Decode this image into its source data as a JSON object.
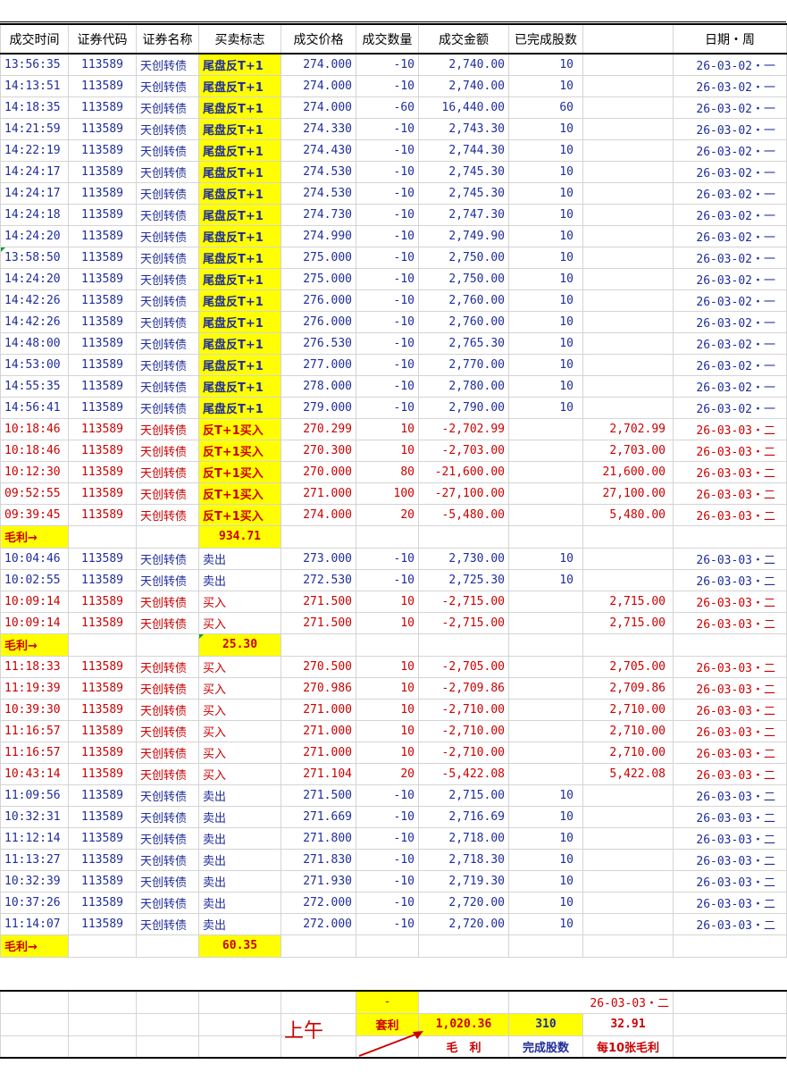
{
  "headers": [
    "成交时间",
    "证券代码",
    "证券名称",
    "买卖标志",
    "成交价格",
    "成交数量",
    "成交金额",
    "已完成股数",
    "",
    "日期・周"
  ],
  "rows": [
    {
      "type": "trade",
      "color": "blue",
      "time": "13:56:35",
      "code": "113589",
      "name": "天创转债",
      "flag": "尾盘反T+1",
      "flag_hl": true,
      "price": "274.000",
      "qty": "-10",
      "amount": "2,740.00",
      "done": "10",
      "extra": "",
      "date": "26-03-02・一"
    },
    {
      "type": "trade",
      "color": "blue",
      "time": "14:13:51",
      "code": "113589",
      "name": "天创转债",
      "flag": "尾盘反T+1",
      "flag_hl": true,
      "price": "274.000",
      "qty": "-10",
      "amount": "2,740.00",
      "done": "10",
      "extra": "",
      "date": "26-03-02・一"
    },
    {
      "type": "trade",
      "color": "blue",
      "time": "14:18:35",
      "code": "113589",
      "name": "天创转债",
      "flag": "尾盘反T+1",
      "flag_hl": true,
      "price": "274.000",
      "qty": "-60",
      "amount": "16,440.00",
      "done": "60",
      "extra": "",
      "date": "26-03-02・一"
    },
    {
      "type": "trade",
      "color": "blue",
      "time": "14:21:59",
      "code": "113589",
      "name": "天创转债",
      "flag": "尾盘反T+1",
      "flag_hl": true,
      "price": "274.330",
      "qty": "-10",
      "amount": "2,743.30",
      "done": "10",
      "extra": "",
      "date": "26-03-02・一"
    },
    {
      "type": "trade",
      "color": "blue",
      "time": "14:22:19",
      "code": "113589",
      "name": "天创转债",
      "flag": "尾盘反T+1",
      "flag_hl": true,
      "price": "274.430",
      "qty": "-10",
      "amount": "2,744.30",
      "done": "10",
      "extra": "",
      "date": "26-03-02・一"
    },
    {
      "type": "trade",
      "color": "blue",
      "time": "14:24:17",
      "code": "113589",
      "name": "天创转债",
      "flag": "尾盘反T+1",
      "flag_hl": true,
      "price": "274.530",
      "qty": "-10",
      "amount": "2,745.30",
      "done": "10",
      "extra": "",
      "date": "26-03-02・一"
    },
    {
      "type": "trade",
      "color": "blue",
      "time": "14:24:17",
      "code": "113589",
      "name": "天创转债",
      "flag": "尾盘反T+1",
      "flag_hl": true,
      "price": "274.530",
      "qty": "-10",
      "amount": "2,745.30",
      "done": "10",
      "extra": "",
      "date": "26-03-02・一"
    },
    {
      "type": "trade",
      "color": "blue",
      "time": "14:24:18",
      "code": "113589",
      "name": "天创转债",
      "flag": "尾盘反T+1",
      "flag_hl": true,
      "price": "274.730",
      "qty": "-10",
      "amount": "2,747.30",
      "done": "10",
      "extra": "",
      "date": "26-03-02・一"
    },
    {
      "type": "trade",
      "color": "blue",
      "time": "14:24:20",
      "code": "113589",
      "name": "天创转债",
      "flag": "尾盘反T+1",
      "flag_hl": true,
      "price": "274.990",
      "qty": "-10",
      "amount": "2,749.90",
      "done": "10",
      "extra": "",
      "date": "26-03-02・一"
    },
    {
      "type": "trade",
      "color": "blue",
      "time": "13:58:50",
      "code": "113589",
      "name": "天创转债",
      "flag": "尾盘反T+1",
      "flag_hl": true,
      "price": "275.000",
      "qty": "-10",
      "amount": "2,750.00",
      "done": "10",
      "extra": "",
      "date": "26-03-02・一",
      "marker": true
    },
    {
      "type": "trade",
      "color": "blue",
      "time": "14:24:20",
      "code": "113589",
      "name": "天创转债",
      "flag": "尾盘反T+1",
      "flag_hl": true,
      "price": "275.000",
      "qty": "-10",
      "amount": "2,750.00",
      "done": "10",
      "extra": "",
      "date": "26-03-02・一"
    },
    {
      "type": "trade",
      "color": "blue",
      "time": "14:42:26",
      "code": "113589",
      "name": "天创转债",
      "flag": "尾盘反T+1",
      "flag_hl": true,
      "price": "276.000",
      "qty": "-10",
      "amount": "2,760.00",
      "done": "10",
      "extra": "",
      "date": "26-03-02・一"
    },
    {
      "type": "trade",
      "color": "blue",
      "time": "14:42:26",
      "code": "113589",
      "name": "天创转债",
      "flag": "尾盘反T+1",
      "flag_hl": true,
      "price": "276.000",
      "qty": "-10",
      "amount": "2,760.00",
      "done": "10",
      "extra": "",
      "date": "26-03-02・一"
    },
    {
      "type": "trade",
      "color": "blue",
      "time": "14:48:00",
      "code": "113589",
      "name": "天创转债",
      "flag": "尾盘反T+1",
      "flag_hl": true,
      "price": "276.530",
      "qty": "-10",
      "amount": "2,765.30",
      "done": "10",
      "extra": "",
      "date": "26-03-02・一"
    },
    {
      "type": "trade",
      "color": "blue",
      "time": "14:53:00",
      "code": "113589",
      "name": "天创转债",
      "flag": "尾盘反T+1",
      "flag_hl": true,
      "price": "277.000",
      "qty": "-10",
      "amount": "2,770.00",
      "done": "10",
      "extra": "",
      "date": "26-03-02・一"
    },
    {
      "type": "trade",
      "color": "blue",
      "time": "14:55:35",
      "code": "113589",
      "name": "天创转债",
      "flag": "尾盘反T+1",
      "flag_hl": true,
      "price": "278.000",
      "qty": "-10",
      "amount": "2,780.00",
      "done": "10",
      "extra": "",
      "date": "26-03-02・一"
    },
    {
      "type": "trade",
      "color": "blue",
      "time": "14:56:41",
      "code": "113589",
      "name": "天创转债",
      "flag": "尾盘反T+1",
      "flag_hl": true,
      "price": "279.000",
      "qty": "-10",
      "amount": "2,790.00",
      "done": "10",
      "extra": "",
      "date": "26-03-02・一"
    },
    {
      "type": "trade",
      "color": "red",
      "time": "10:18:46",
      "code": "113589",
      "name": "天创转债",
      "flag": "反T+1买入",
      "flag_hl": true,
      "price": "270.299",
      "qty": "10",
      "amount": "-2,702.99",
      "done": "",
      "extra": "2,702.99",
      "date": "26-03-03・二"
    },
    {
      "type": "trade",
      "color": "red",
      "time": "10:18:46",
      "code": "113589",
      "name": "天创转债",
      "flag": "反T+1买入",
      "flag_hl": true,
      "price": "270.300",
      "qty": "10",
      "amount": "-2,703.00",
      "done": "",
      "extra": "2,703.00",
      "date": "26-03-03・二"
    },
    {
      "type": "trade",
      "color": "red",
      "time": "10:12:30",
      "code": "113589",
      "name": "天创转债",
      "flag": "反T+1买入",
      "flag_hl": true,
      "price": "270.000",
      "qty": "80",
      "amount": "-21,600.00",
      "done": "",
      "extra": "21,600.00",
      "date": "26-03-03・二"
    },
    {
      "type": "trade",
      "color": "red",
      "time": "09:52:55",
      "code": "113589",
      "name": "天创转债",
      "flag": "反T+1买入",
      "flag_hl": true,
      "price": "271.000",
      "qty": "100",
      "amount": "-27,100.00",
      "done": "",
      "extra": "27,100.00",
      "date": "26-03-03・二"
    },
    {
      "type": "trade",
      "color": "red",
      "time": "09:39:45",
      "code": "113589",
      "name": "天创转债",
      "flag": "反T+1买入",
      "flag_hl": true,
      "price": "274.000",
      "qty": "20",
      "amount": "-5,480.00",
      "done": "",
      "extra": "5,480.00",
      "date": "26-03-03・二"
    },
    {
      "type": "sum",
      "label": "毛利→",
      "value": "934.71"
    },
    {
      "type": "trade",
      "color": "blue",
      "time": "10:04:46",
      "code": "113589",
      "name": "天创转债",
      "flag": "卖出",
      "flag_hl": false,
      "price": "273.000",
      "qty": "-10",
      "amount": "2,730.00",
      "done": "10",
      "extra": "",
      "date": "26-03-03・二"
    },
    {
      "type": "trade",
      "color": "blue",
      "time": "10:02:55",
      "code": "113589",
      "name": "天创转债",
      "flag": "卖出",
      "flag_hl": false,
      "price": "272.530",
      "qty": "-10",
      "amount": "2,725.30",
      "done": "10",
      "extra": "",
      "date": "26-03-03・二"
    },
    {
      "type": "trade",
      "color": "red",
      "time": "10:09:14",
      "code": "113589",
      "name": "天创转债",
      "flag": "买入",
      "flag_hl": false,
      "price": "271.500",
      "qty": "10",
      "amount": "-2,715.00",
      "done": "",
      "extra": "2,715.00",
      "date": "26-03-03・二"
    },
    {
      "type": "trade",
      "color": "red",
      "time": "10:09:14",
      "code": "113589",
      "name": "天创转债",
      "flag": "买入",
      "flag_hl": false,
      "price": "271.500",
      "qty": "10",
      "amount": "-2,715.00",
      "done": "",
      "extra": "2,715.00",
      "date": "26-03-03・二"
    },
    {
      "type": "sum",
      "label": "毛利→",
      "value": "25.30",
      "marker": true
    },
    {
      "type": "trade",
      "color": "red",
      "time": "11:18:33",
      "code": "113589",
      "name": "天创转债",
      "flag": "买入",
      "flag_hl": false,
      "price": "270.500",
      "qty": "10",
      "amount": "-2,705.00",
      "done": "",
      "extra": "2,705.00",
      "date": "26-03-03・二"
    },
    {
      "type": "trade",
      "color": "red",
      "time": "11:19:39",
      "code": "113589",
      "name": "天创转债",
      "flag": "买入",
      "flag_hl": false,
      "price": "270.986",
      "qty": "10",
      "amount": "-2,709.86",
      "done": "",
      "extra": "2,709.86",
      "date": "26-03-03・二"
    },
    {
      "type": "trade",
      "color": "red",
      "time": "10:39:30",
      "code": "113589",
      "name": "天创转债",
      "flag": "买入",
      "flag_hl": false,
      "price": "271.000",
      "qty": "10",
      "amount": "-2,710.00",
      "done": "",
      "extra": "2,710.00",
      "date": "26-03-03・二"
    },
    {
      "type": "trade",
      "color": "red",
      "time": "11:16:57",
      "code": "113589",
      "name": "天创转债",
      "flag": "买入",
      "flag_hl": false,
      "price": "271.000",
      "qty": "10",
      "amount": "-2,710.00",
      "done": "",
      "extra": "2,710.00",
      "date": "26-03-03・二"
    },
    {
      "type": "trade",
      "color": "red",
      "time": "11:16:57",
      "code": "113589",
      "name": "天创转债",
      "flag": "买入",
      "flag_hl": false,
      "price": "271.000",
      "qty": "10",
      "amount": "-2,710.00",
      "done": "",
      "extra": "2,710.00",
      "date": "26-03-03・二"
    },
    {
      "type": "trade",
      "color": "red",
      "time": "10:43:14",
      "code": "113589",
      "name": "天创转债",
      "flag": "买入",
      "flag_hl": false,
      "price": "271.104",
      "qty": "20",
      "amount": "-5,422.08",
      "done": "",
      "extra": "5,422.08",
      "date": "26-03-03・二"
    },
    {
      "type": "trade",
      "color": "blue",
      "time": "11:09:56",
      "code": "113589",
      "name": "天创转债",
      "flag": "卖出",
      "flag_hl": false,
      "price": "271.500",
      "qty": "-10",
      "amount": "2,715.00",
      "done": "10",
      "extra": "",
      "date": "26-03-03・二"
    },
    {
      "type": "trade",
      "color": "blue",
      "time": "10:32:31",
      "code": "113589",
      "name": "天创转债",
      "flag": "卖出",
      "flag_hl": false,
      "price": "271.669",
      "qty": "-10",
      "amount": "2,716.69",
      "done": "10",
      "extra": "",
      "date": "26-03-03・二"
    },
    {
      "type": "trade",
      "color": "blue",
      "time": "11:12:14",
      "code": "113589",
      "name": "天创转债",
      "flag": "卖出",
      "flag_hl": false,
      "price": "271.800",
      "qty": "-10",
      "amount": "2,718.00",
      "done": "10",
      "extra": "",
      "date": "26-03-03・二"
    },
    {
      "type": "trade",
      "color": "blue",
      "time": "11:13:27",
      "code": "113589",
      "name": "天创转债",
      "flag": "卖出",
      "flag_hl": false,
      "price": "271.830",
      "qty": "-10",
      "amount": "2,718.30",
      "done": "10",
      "extra": "",
      "date": "26-03-03・二"
    },
    {
      "type": "trade",
      "color": "blue",
      "time": "10:32:39",
      "code": "113589",
      "name": "天创转债",
      "flag": "卖出",
      "flag_hl": false,
      "price": "271.930",
      "qty": "-10",
      "amount": "2,719.30",
      "done": "10",
      "extra": "",
      "date": "26-03-03・二"
    },
    {
      "type": "trade",
      "color": "blue",
      "time": "10:37:26",
      "code": "113589",
      "name": "天创转债",
      "flag": "卖出",
      "flag_hl": false,
      "price": "272.000",
      "qty": "-10",
      "amount": "2,720.00",
      "done": "10",
      "extra": "",
      "date": "26-03-03・二"
    },
    {
      "type": "trade",
      "color": "blue",
      "time": "11:14:07",
      "code": "113589",
      "name": "天创转债",
      "flag": "卖出",
      "flag_hl": false,
      "price": "272.000",
      "qty": "-10",
      "amount": "2,720.00",
      "done": "10",
      "extra": "",
      "date": "26-03-03・二"
    },
    {
      "type": "sum",
      "label": "毛利→",
      "value": "60.35"
    }
  ],
  "footer": {
    "dash": "-",
    "date": "26-03-03・二",
    "arbitrage_label": "套利",
    "arbitrage_value": "1,020.36",
    "done_total": "310",
    "per10": "32.91",
    "label_gross": "毛　利",
    "label_done": "完成股数",
    "label_per10": "每10张毛利",
    "session_label": "上午"
  },
  "colors": {
    "buy": "#cc0000",
    "sell": "#1f2d9c",
    "highlight": "#ffff00"
  }
}
